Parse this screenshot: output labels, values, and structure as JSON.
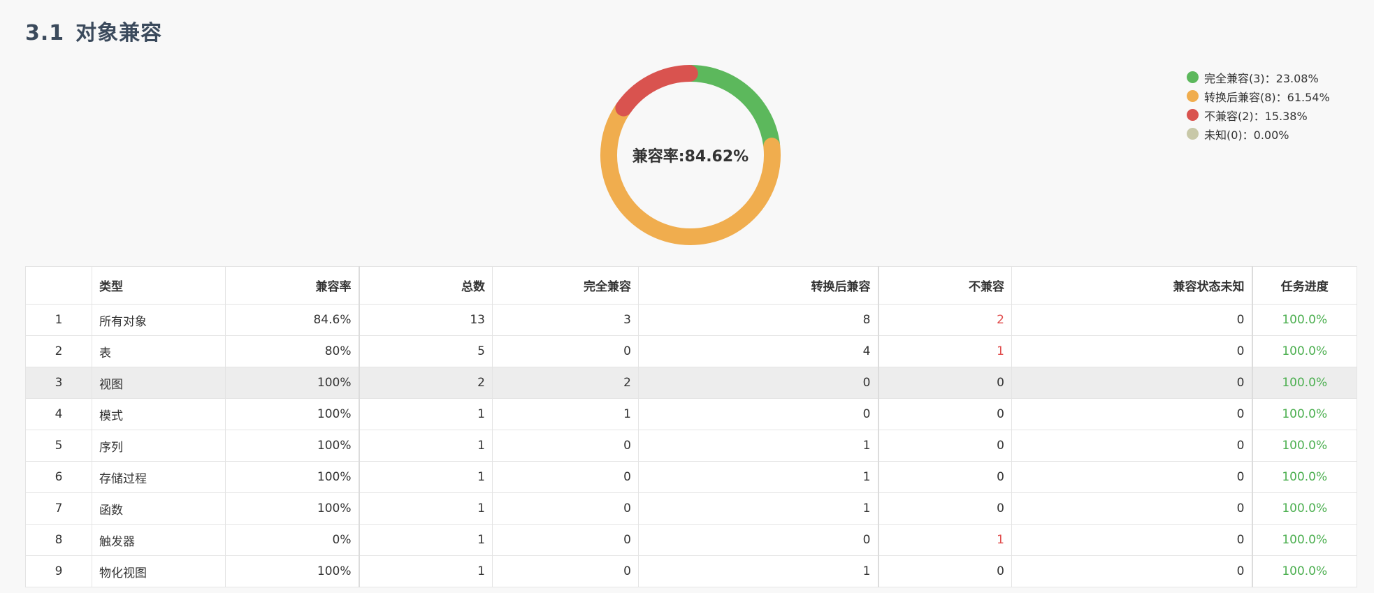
{
  "page": {
    "section_number": "3.1",
    "section_title": "对象兼容"
  },
  "chart_data": {
    "type": "pie",
    "variant": "donut",
    "center_label": "兼容率:84.62%",
    "legend_placement": "top-right",
    "slices": [
      {
        "label": "完全兼容(3)：23.08%",
        "value": 3,
        "percent": 23.08,
        "color": "#5cb85c"
      },
      {
        "label": "转换后兼容(8)：61.54%",
        "value": 8,
        "percent": 61.54,
        "color": "#f0ad4e"
      },
      {
        "label": "不兼容(2)：15.38%",
        "value": 2,
        "percent": 15.38,
        "color": "#d9534f"
      },
      {
        "label": "未知(0)：0.00%",
        "value": 0,
        "percent": 0.0,
        "color": "#c8c8a8"
      }
    ]
  },
  "table": {
    "headers": [
      "",
      "类型",
      "兼容率",
      "总数",
      "完全兼容",
      "转换后兼容",
      "不兼容",
      "兼容状态未知",
      "任务进度"
    ],
    "rows": [
      {
        "idx": "1",
        "type": "所有对象",
        "rate": "84.6%",
        "total": "13",
        "full": "3",
        "converted": "8",
        "incompatible": "2",
        "unknown": "0",
        "progress": "100.0%"
      },
      {
        "idx": "2",
        "type": "表",
        "rate": "80%",
        "total": "5",
        "full": "0",
        "converted": "4",
        "incompatible": "1",
        "unknown": "0",
        "progress": "100.0%"
      },
      {
        "idx": "3",
        "type": "视图",
        "rate": "100%",
        "total": "2",
        "full": "2",
        "converted": "0",
        "incompatible": "0",
        "unknown": "0",
        "progress": "100.0%"
      },
      {
        "idx": "4",
        "type": "模式",
        "rate": "100%",
        "total": "1",
        "full": "1",
        "converted": "0",
        "incompatible": "0",
        "unknown": "0",
        "progress": "100.0%"
      },
      {
        "idx": "5",
        "type": "序列",
        "rate": "100%",
        "total": "1",
        "full": "0",
        "converted": "1",
        "incompatible": "0",
        "unknown": "0",
        "progress": "100.0%"
      },
      {
        "idx": "6",
        "type": "存储过程",
        "rate": "100%",
        "total": "1",
        "full": "0",
        "converted": "1",
        "incompatible": "0",
        "unknown": "0",
        "progress": "100.0%"
      },
      {
        "idx": "7",
        "type": "函数",
        "rate": "100%",
        "total": "1",
        "full": "0",
        "converted": "1",
        "incompatible": "0",
        "unknown": "0",
        "progress": "100.0%"
      },
      {
        "idx": "8",
        "type": "触发器",
        "rate": "0%",
        "total": "1",
        "full": "0",
        "converted": "0",
        "incompatible": "1",
        "unknown": "0",
        "progress": "100.0%"
      },
      {
        "idx": "9",
        "type": "物化视图",
        "rate": "100%",
        "total": "1",
        "full": "0",
        "converted": "1",
        "incompatible": "0",
        "unknown": "0",
        "progress": "100.0%"
      }
    ],
    "highlighted_row_index": 2
  }
}
